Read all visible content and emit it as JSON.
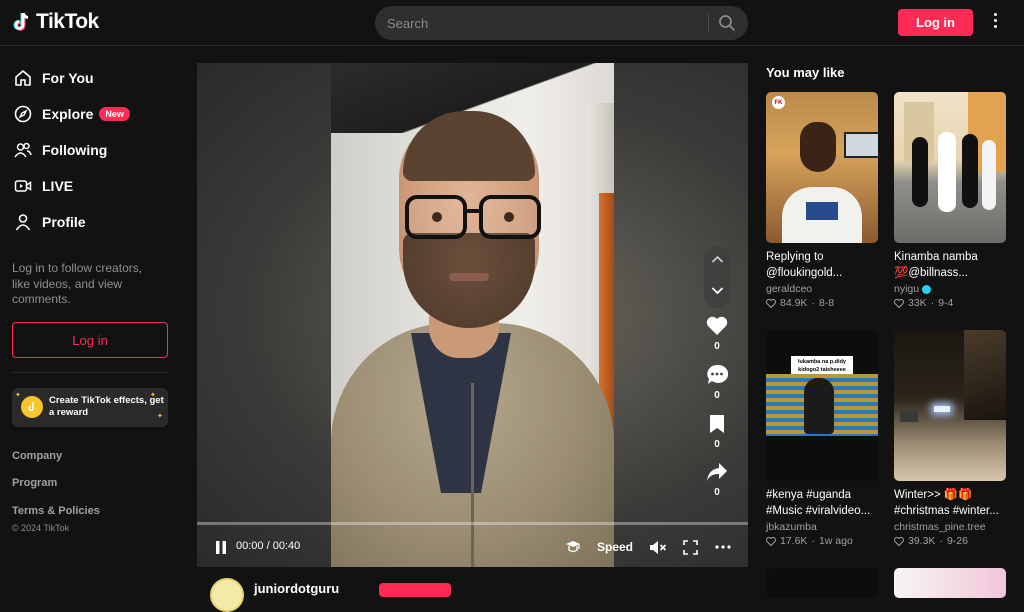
{
  "header": {
    "logo_text": "TikTok",
    "search_placeholder": "Search",
    "login_label": "Log in"
  },
  "sidebar": {
    "items": [
      {
        "label": "For You",
        "icon": "home-icon"
      },
      {
        "label": "Explore",
        "icon": "compass-icon",
        "badge": "New"
      },
      {
        "label": "Following",
        "icon": "users-icon"
      },
      {
        "label": "LIVE",
        "icon": "live-icon"
      },
      {
        "label": "Profile",
        "icon": "user-icon"
      }
    ],
    "hint": "Log in to follow creators, like videos, and view comments.",
    "login_label": "Log in",
    "effects_label": "Create TikTok effects, get a reward",
    "footer": [
      "Company",
      "Program",
      "Terms & Policies"
    ],
    "copyright": "© 2024 TikTok"
  },
  "player": {
    "time": "00:00 / 00:40",
    "speed_label": "Speed",
    "actions": [
      {
        "icon": "heart-icon",
        "count": "0"
      },
      {
        "icon": "comment-icon",
        "count": "0"
      },
      {
        "icon": "bookmark-icon",
        "count": "0"
      },
      {
        "icon": "share-icon",
        "count": "0"
      }
    ],
    "author": "juniordotguru"
  },
  "recommendations": {
    "title": "You may like",
    "cards": [
      {
        "caption": "Replying to @floukingold...",
        "author": "geraldceo",
        "verified": false,
        "likes": "84.9K",
        "date": "8-8",
        "thumb_text": "FK"
      },
      {
        "caption": "Kinamba namba 💯@billnass...",
        "author": "nyigu",
        "verified": true,
        "likes": "33K",
        "date": "9-4"
      },
      {
        "caption": "#kenya #uganda #Music #viralvideo...",
        "author": "jbkazumba",
        "verified": false,
        "likes": "17.6K",
        "date": "1w ago",
        "thumb_text": "lukamba na p,didy kidogo2 taisheeee"
      },
      {
        "caption": "Winter>> 🎁🎁 #christmas #winter...",
        "author": "christmas_pine.tree",
        "verified": false,
        "likes": "39.3K",
        "date": "9-26"
      }
    ]
  }
}
